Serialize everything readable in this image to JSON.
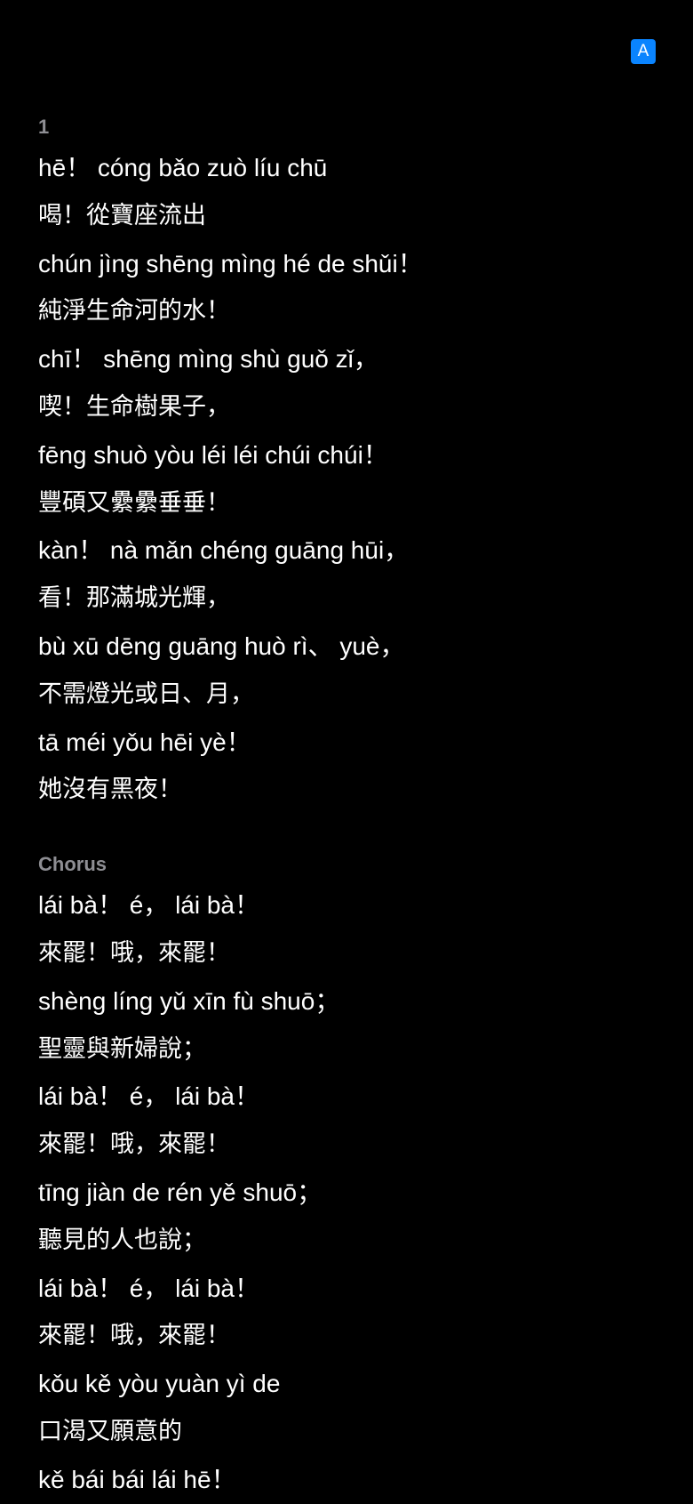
{
  "toolbar": {
    "font_toggle_label": "A"
  },
  "colors": {
    "background": "#000000",
    "text": "#ffffff",
    "section_label": "#8e8e93",
    "accent": "#0a84ff"
  },
  "sections": [
    {
      "label": "1",
      "lines": [
        "hē！ cóng bǎo zuò líu chū",
        "喝！從寶座流出",
        "chún jìng shēng mìng hé de shǔi！",
        "純淨生命河的水！",
        "chī！ shēng mìng shù guǒ zǐ，",
        "喫！生命樹果子，",
        "fēng shuò yòu léi léi chúi chúi！",
        "豐碩又纍纍垂垂！",
        "kàn！ nà mǎn chéng guāng hūi，",
        "看！那滿城光輝，",
        "bù xū dēng guāng huò rì、 yuè，",
        "不需燈光或日、月，",
        "tā méi yǒu hēi yè！",
        "她沒有黑夜！"
      ]
    },
    {
      "label": "Chorus",
      "lines": [
        "lái bà！ é， lái bà！",
        "來罷！哦，來罷！",
        "shèng líng yǔ xīn fù shuō；",
        "聖靈與新婦說；",
        "lái bà！ é， lái bà！",
        "來罷！哦，來罷！",
        "tīng jiàn de rén yě shuō；",
        "聽見的人也說；",
        "lái bà！ é， lái bà！",
        "來罷！哦，來罷！",
        "kǒu kě yòu yuàn yì de",
        "口渴又願意的",
        "kě bái bái lái hē！"
      ]
    }
  ]
}
